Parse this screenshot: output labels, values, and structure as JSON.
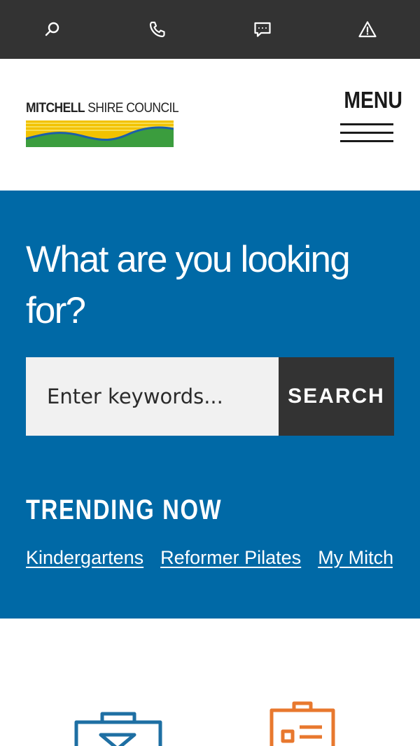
{
  "utility_bar": {
    "items": [
      {
        "icon": "search-icon"
      },
      {
        "icon": "phone-icon"
      },
      {
        "icon": "chat-icon"
      },
      {
        "icon": "alert-icon"
      }
    ]
  },
  "header": {
    "logo_bold": "MITCHELL",
    "logo_rest": " SHIRE COUNCIL",
    "menu_label": "MENU"
  },
  "search": {
    "title": "What are you looking for?",
    "placeholder": "Enter keywords...",
    "button_label": "SEARCH"
  },
  "trending": {
    "heading": "TRENDING NOW",
    "links": [
      "Kindergartens",
      "Reformer Pilates",
      "My Mitchell"
    ]
  },
  "colors": {
    "utility_bar": "#333333",
    "hero_blue": "#0069a6",
    "search_button": "#333333",
    "tile_icon_blue": "#1e6fa3",
    "tile_icon_orange": "#e8782e"
  }
}
